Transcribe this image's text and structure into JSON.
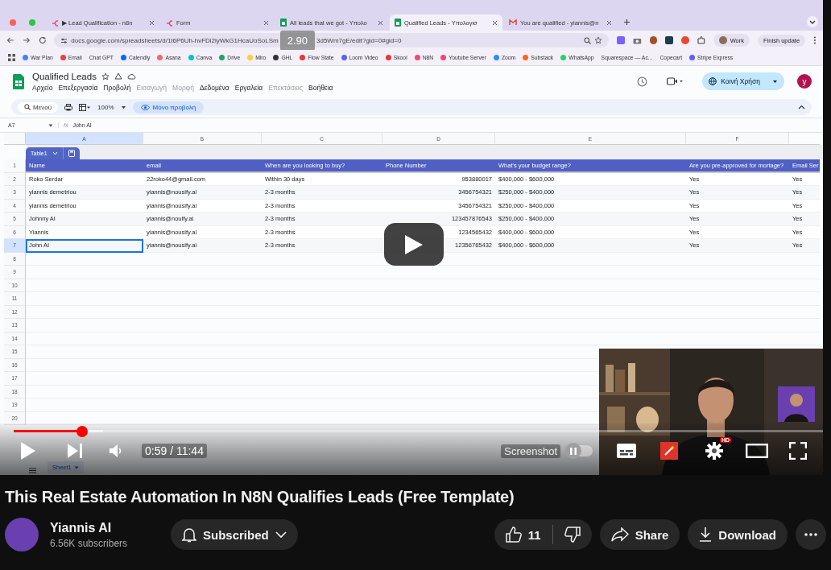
{
  "browser": {
    "tabs": [
      {
        "title": "▶ Lead Qualification - n8n",
        "kind": "workflow",
        "selected": false
      },
      {
        "title": "Form",
        "kind": "workflow",
        "selected": false
      },
      {
        "title": "All leads that we got - Υπολο",
        "kind": "spreadsheet",
        "selected": false
      },
      {
        "title": "Qualified Leads - Υπολογισ",
        "kind": "spreadsheet",
        "selected": true
      },
      {
        "title": "You are qualified - yiannis@n",
        "kind": "mail",
        "selected": false
      }
    ],
    "url_start": "docs.google.com/spreadsheets/d/1t6P6Uh-hvFDi2lyWkG1HcaUoSoLSm",
    "playback_speed": "2.90",
    "url_end": "3d5Wm7gE/edit?gid=0#gid=0",
    "profile": "Work",
    "update_button": "Finish update",
    "bookmarks": [
      {
        "label": "War Plan",
        "color": "#4285f4"
      },
      {
        "label": "Email",
        "color": "#ea4335"
      },
      {
        "label": "Chat GPT"
      },
      {
        "label": "Calendly",
        "color": "#006bff"
      },
      {
        "label": "Asana",
        "color": "#f06a6a"
      },
      {
        "label": "Canva",
        "color": "#00c4cc"
      },
      {
        "label": "Drive",
        "color": "#1fa463"
      },
      {
        "label": "Miro",
        "color": "#ffd02f"
      },
      {
        "label": "GHL",
        "color": "#333333"
      },
      {
        "label": "Flow State",
        "color": "#e53935"
      },
      {
        "label": "Loom Video",
        "color": "#625df5"
      },
      {
        "label": "Skool",
        "color": "#e53935"
      },
      {
        "label": "N8N",
        "color": "#ea4b71"
      },
      {
        "label": "Youtube Server",
        "color": "#ea4b71"
      },
      {
        "label": "Zoom",
        "color": "#2d8cff"
      },
      {
        "label": "Substack",
        "color": "#ff6719"
      },
      {
        "label": "WhatsApp",
        "color": "#25d366"
      },
      {
        "label": "Squarespace — Ac..."
      },
      {
        "label": "Copecart"
      },
      {
        "label": "Stripe Express",
        "color": "#635bff"
      }
    ]
  },
  "sheet": {
    "title": "Qualified Leads",
    "menus": [
      {
        "label": "Αρχείο",
        "disabled": false
      },
      {
        "label": "Επεξεργασία",
        "disabled": false
      },
      {
        "label": "Προβολή",
        "disabled": false
      },
      {
        "label": "Εισαγωγή",
        "disabled": true
      },
      {
        "label": "Μορφή",
        "disabled": true
      },
      {
        "label": "Δεδομένα",
        "disabled": false
      },
      {
        "label": "Εργαλεία",
        "disabled": false
      },
      {
        "label": "Επεκτάσεις",
        "disabled": true
      },
      {
        "label": "Βοήθεια",
        "disabled": false
      }
    ],
    "share_button": "Κοινή Χρήση",
    "account_initial": "y",
    "search": "Μενού",
    "zoom": "100%",
    "mode_button": "Μόνο προβολή",
    "cell_ref": "A7",
    "formula_icon": "fx",
    "formula_value": "John AI",
    "columns": [
      {
        "letter": "A",
        "selected": true
      },
      {
        "letter": "B",
        "selected": false
      },
      {
        "letter": "C",
        "selected": false
      },
      {
        "letter": "D",
        "selected": false
      },
      {
        "letter": "E",
        "selected": false
      },
      {
        "letter": "F",
        "selected": false
      }
    ],
    "table_name": "Table1",
    "header": [
      "Name",
      "email",
      "When are you looking to buy?",
      "Phone Number",
      "What's your budget range?",
      "Are you pre-approved for mortage?",
      "Email Ser"
    ],
    "rows": [
      {
        "cells": [
          "Roko Serdar",
          "22roko44@gmail.com",
          "Within 30 days",
          "953880017",
          "$400,000 - $600,000",
          "Yes",
          "Yes"
        ],
        "name_cell_selected": false
      },
      {
        "cells": [
          "yiannis demetriou",
          "yiannis@nousify.ai",
          "2-3 months",
          "3456754321",
          "$250,000 - $400,000",
          "Yes",
          "Yes"
        ],
        "name_cell_selected": false
      },
      {
        "cells": [
          "yiannis demetriou",
          "yiannis@nousify.ai",
          "2-3 months",
          "3456754321",
          "$250,000 - $400,000",
          "Yes",
          "Yes"
        ],
        "name_cell_selected": false
      },
      {
        "cells": [
          "Johnny AI",
          "yiannis@noulfy.ai",
          "2-3 months",
          "123457876543",
          "$250,000 - $400,000",
          "Yes",
          "Yes"
        ],
        "name_cell_selected": false
      },
      {
        "cells": [
          "Yiannis",
          "yiannis@nousify.ai",
          "2-3 months",
          "1234565432",
          "$400,000 - $600,000",
          "Yes",
          "Yes"
        ],
        "name_cell_selected": false
      },
      {
        "cells": [
          "John AI",
          "yiannis@nousify.ai",
          "2-3 months",
          "12356765432",
          "$400,000 - $600,000",
          "Yes",
          "Yes"
        ],
        "name_cell_selected": true
      }
    ],
    "row_numbers": [
      {
        "label": "1",
        "selected": false
      },
      {
        "label": "2",
        "selected": false
      },
      {
        "label": "3",
        "selected": false
      },
      {
        "label": "4",
        "selected": false
      },
      {
        "label": "5",
        "selected": false
      },
      {
        "label": "6",
        "selected": false
      },
      {
        "label": "7",
        "selected": true
      },
      {
        "label": "8",
        "selected": false
      },
      {
        "label": "9",
        "selected": false
      },
      {
        "label": "10",
        "selected": false
      },
      {
        "label": "11",
        "selected": false
      },
      {
        "label": "12",
        "selected": false
      },
      {
        "label": "13",
        "selected": false
      },
      {
        "label": "14",
        "selected": false
      },
      {
        "label": "15",
        "selected": false
      },
      {
        "label": "16",
        "selected": false
      },
      {
        "label": "17",
        "selected": false
      },
      {
        "label": "18",
        "selected": false
      },
      {
        "label": "19",
        "selected": false
      },
      {
        "label": "20",
        "selected": false
      }
    ],
    "sheet_tab": "Sheet1"
  },
  "player": {
    "progress": {
      "level": 0.085
    },
    "buffer": {
      "level": 0.11
    },
    "time": "0:59 / 11:44",
    "screenshot_label": "Screenshot",
    "screenshot_toggle": {
      "on": false
    },
    "quality_badge": "HD"
  },
  "video": {
    "title": "This Real Estate Automation In N8N Qualifies Leads (Free Template)",
    "channel": "Yiannis AI",
    "subscribers": "6.56K subscribers",
    "subscribe_button": "Subscribed",
    "likes": "11",
    "share_button": "Share",
    "download_button": "Download"
  }
}
